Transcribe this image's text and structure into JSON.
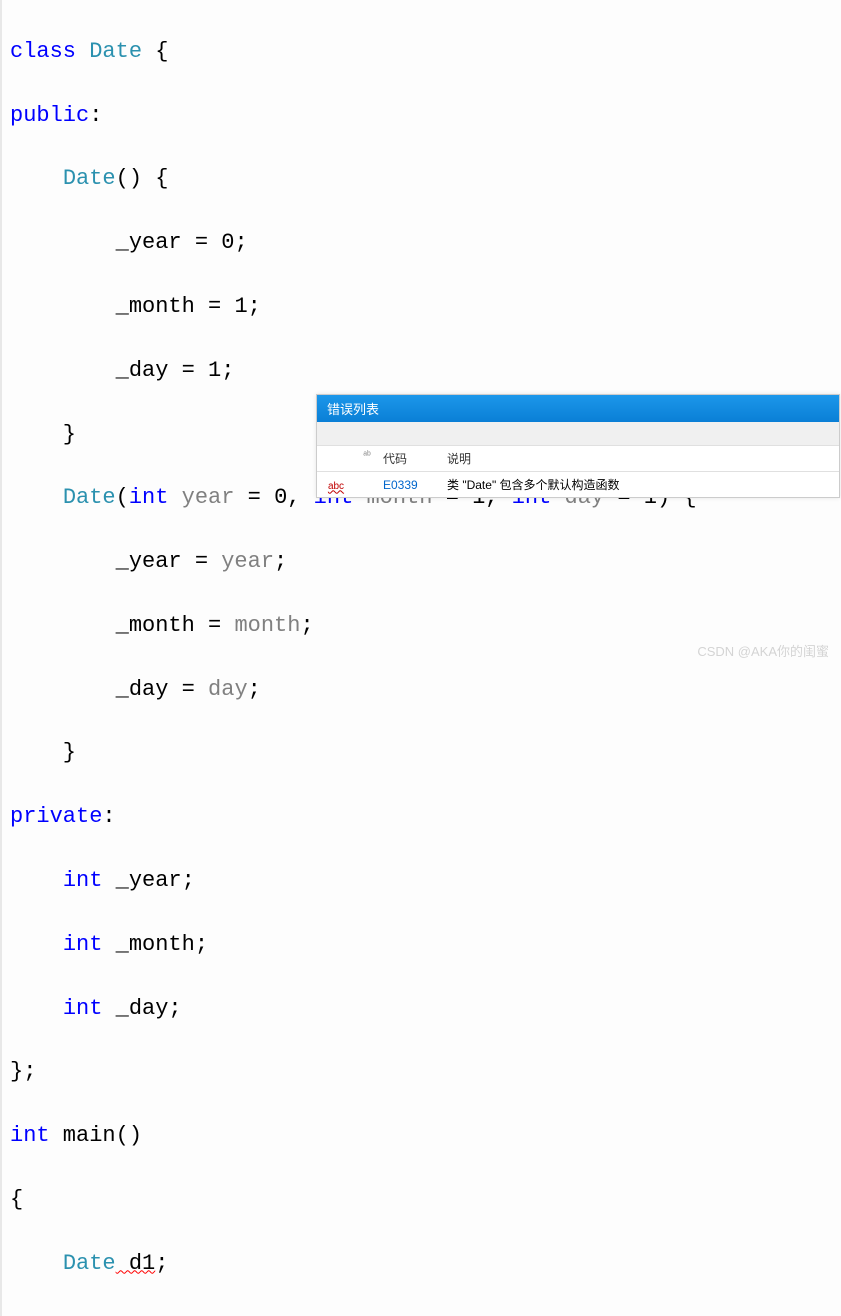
{
  "code": {
    "l1_class": "class",
    "l1_type": "Date",
    "l1_brace": " {",
    "l2_public": "public",
    "l2_colon": ":",
    "l3_ctor": "Date",
    "l3_rest": "() {",
    "l4_year": "        _year = ",
    "l4_val": "0",
    "l4_semi": ";",
    "l5_month": "        _month = ",
    "l5_val": "1",
    "l5_semi": ";",
    "l6_day": "        _day = ",
    "l6_val": "1",
    "l6_semi": ";",
    "l7": "    }",
    "l8_ctor": "Date",
    "l8_p1_type": "int",
    "l8_p1_name": " year",
    "l8_p1_def": " = ",
    "l8_p1_val": "0",
    "l8_c1": ", ",
    "l8_p2_type": "int",
    "l8_p2_name": " month",
    "l8_p2_def": " = ",
    "l8_p2_val": "1",
    "l8_c2": ", ",
    "l8_p3_type": "int",
    "l8_p3_name": " day",
    "l8_p3_def": " = ",
    "l8_p3_val": "1",
    "l8_end": ") {",
    "l9_a": "        _year = ",
    "l9_b": "year",
    "l9_c": ";",
    "l10_a": "        _month = ",
    "l10_b": "month",
    "l10_c": ";",
    "l11_a": "        _day = ",
    "l11_b": "day",
    "l11_c": ";",
    "l12": "    }",
    "l13_private": "private",
    "l13_colon": ":",
    "l14_type": "int",
    "l14_name": " _year;",
    "l15_type": "int",
    "l15_name": " _month;",
    "l16_type": "int",
    "l16_name": " _day;",
    "l17": "};",
    "l18_type": "int",
    "l18_main": " main",
    "l18_rest": "()",
    "l19": "{",
    "l20_type": "Date",
    "l20_name": " d1",
    "l20_semi": ";"
  },
  "panel": {
    "title": "错误列表",
    "header_sup": "ᵃᵇ",
    "header_code": "代码",
    "header_desc": "说明",
    "row_icon": "abc",
    "row_code": "E0339",
    "row_desc": "类 \"Date\" 包含多个默认构造函数"
  },
  "watermark": "CSDN @AKA你的闺蜜"
}
